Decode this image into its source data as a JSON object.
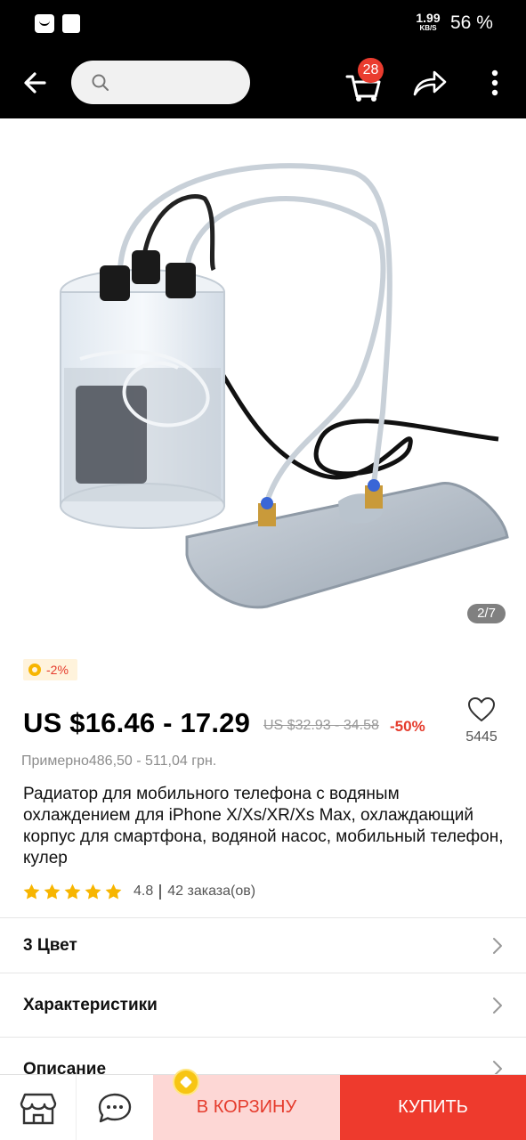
{
  "status_bar": {
    "speed_value": "1.99",
    "speed_unit": "KB/S",
    "battery": "56 %"
  },
  "app_bar": {
    "search_placeholder": "",
    "cart_count": "28"
  },
  "gallery": {
    "counter": "2/7"
  },
  "discount": {
    "label": "-2%"
  },
  "price": {
    "current": "US $16.46 - 17.29",
    "original": "US $32.93 - 34.58",
    "percent_off": "-50%",
    "approx": "Примерно486,50 - 511,04 грн."
  },
  "wishlist": {
    "count": "5445"
  },
  "product": {
    "title": "Радиатор для мобильного телефона с водяным охлаждением для iPhone X/Xs/XR/Xs Max, охлаждающий корпус для смартфона, водяной насос, мобильный телефон, кулер",
    "rating": "4.8",
    "rating_stars": 5,
    "orders": "42 заказа(ов)"
  },
  "sections": {
    "colors": "3 Цвет",
    "specs": "Характеристики",
    "description": "Описание"
  },
  "bottom_bar": {
    "add_to_cart": "В КОРЗИНУ",
    "buy": "КУПИТЬ"
  },
  "colors": {
    "accent": "#e53b2c",
    "buy_bg": "#ee3a2d",
    "cart_bg": "#fdd7d5",
    "discount_bg": "#fff3dc",
    "star": "#f7b500"
  }
}
